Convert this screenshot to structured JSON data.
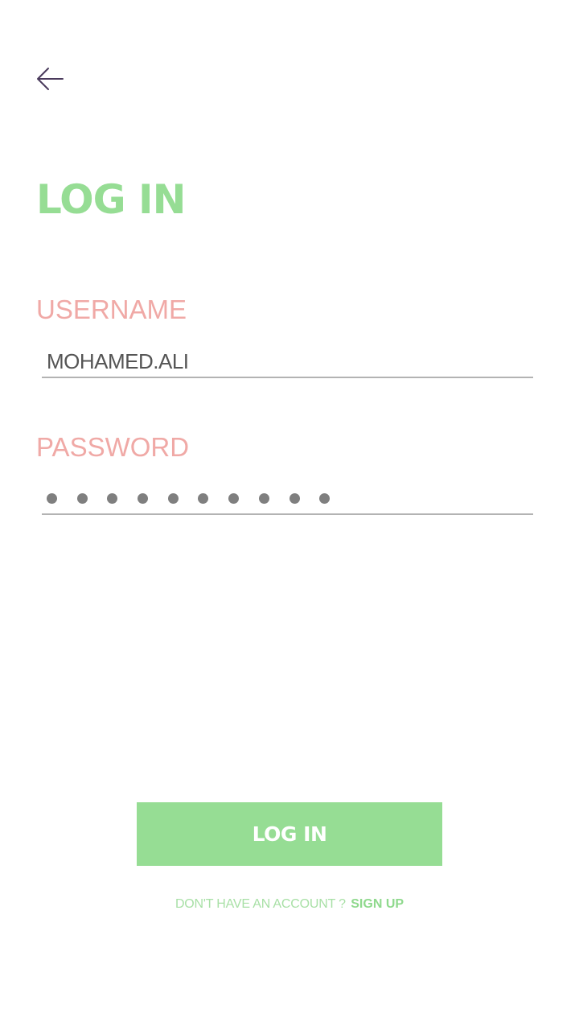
{
  "header": {
    "back_icon": "arrow-left-icon",
    "title": "LOG IN"
  },
  "form": {
    "username": {
      "label": "USERNAME",
      "value": "MOHAMED.ALI"
    },
    "password": {
      "label": "PASSWORD",
      "masked_length": 10
    }
  },
  "actions": {
    "login_label": "LOG IN",
    "signup_prompt": "DON'T HAVE AN ACCOUNT ?",
    "signup_link": "SIGN UP"
  },
  "colors": {
    "accent_green": "#96dd94",
    "label_pink": "#f0a9a6",
    "icon_purple": "#4a3a5c",
    "underline_gray": "#b3b3b3",
    "text_gray": "#555555"
  }
}
